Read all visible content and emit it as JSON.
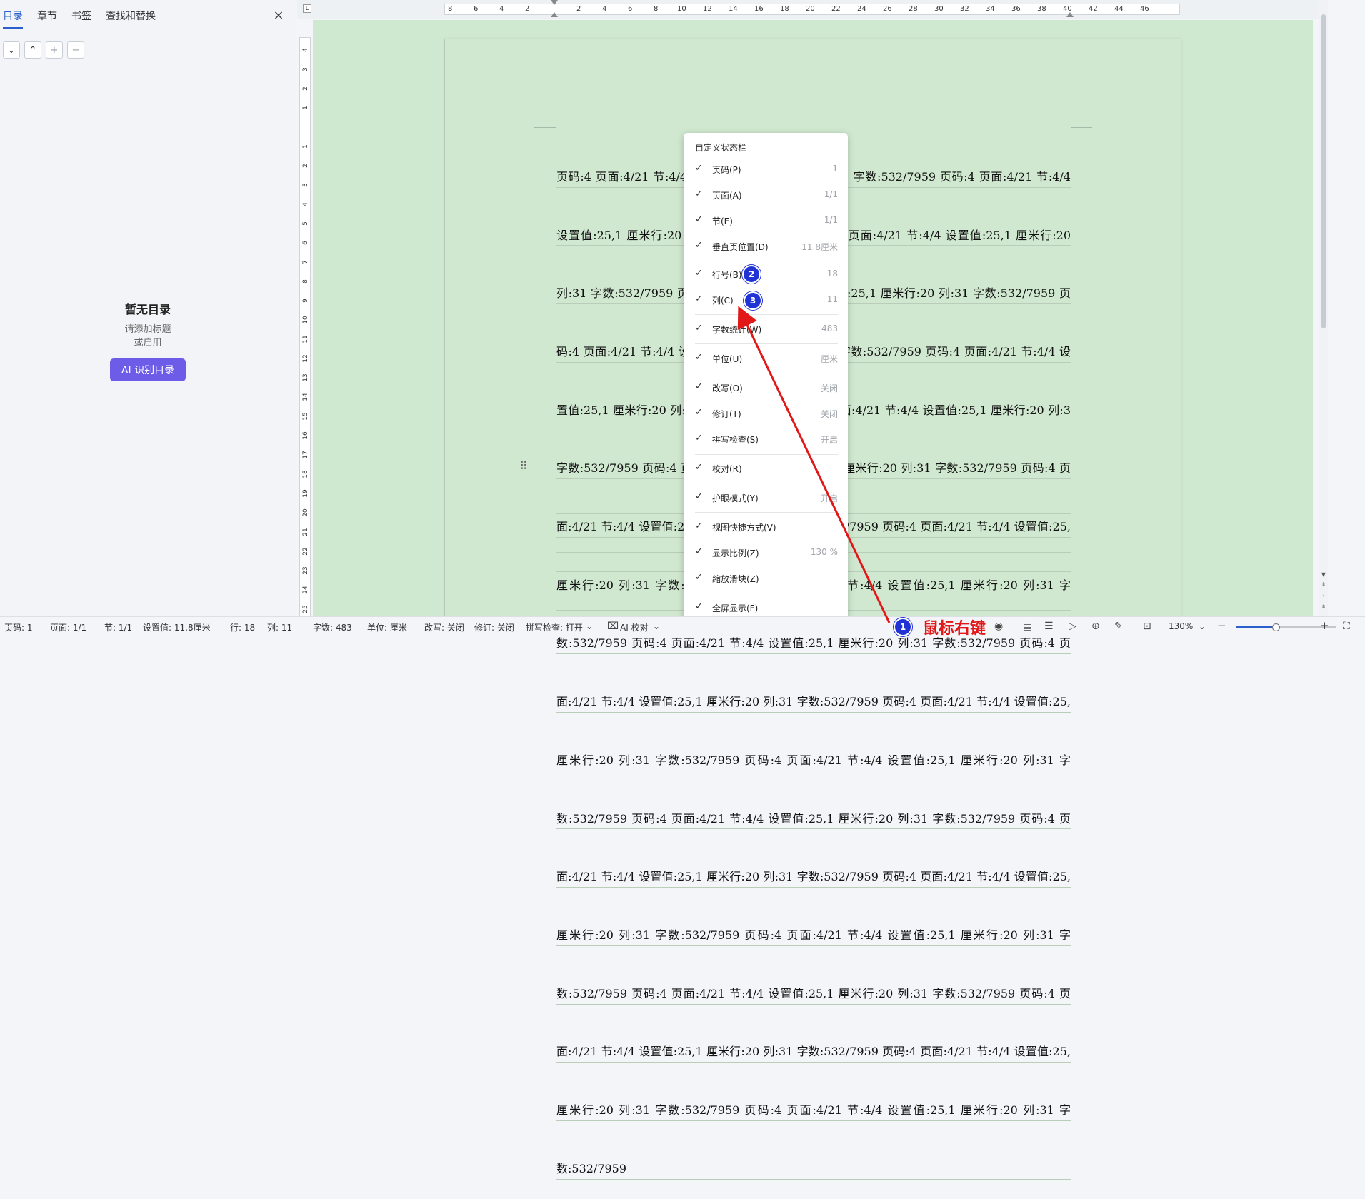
{
  "left_panel": {
    "tabs": [
      "目录",
      "章节",
      "书签",
      "查找和替换"
    ],
    "close_icon": "close-icon",
    "toc_tools": [
      "chevron-down-icon",
      "chevron-up-icon",
      "plus-icon",
      "minus-icon"
    ],
    "empty_title": "暂无目录",
    "empty_hint_1": "请添加标题",
    "empty_hint_2": "或启用",
    "ai_button": "AI 识别目录"
  },
  "hruler_ticks": [
    "8",
    "6",
    "4",
    "2",
    "2",
    "4",
    "6",
    "8",
    "10",
    "12",
    "14",
    "16",
    "18",
    "20",
    "22",
    "24",
    "26",
    "28",
    "30",
    "32",
    "34",
    "36",
    "38",
    "40",
    "42",
    "44",
    "46"
  ],
  "vruler_ticks": [
    "4",
    "3",
    "2",
    "1",
    "1",
    "2",
    "3",
    "4",
    "5",
    "6",
    "7",
    "8",
    "9",
    "10",
    "11",
    "12",
    "13",
    "14",
    "15",
    "16",
    "17",
    "18",
    "19",
    "20",
    "21",
    "22",
    "23",
    "24",
    "25"
  ],
  "document": {
    "lines": [
      "页码:4 页面:4/21 节:4/4 设置值:25,1 厘米行:20 列:31 字数:532/7959 页码:4 页面:4/21 节:4/4",
      "设置值:25,1 厘米行:20 列:31 字数:532/7959 页码:4 页面:4/21 节:4/4 设置值:25,1 厘米行:20",
      "列:31 字数:532/7959 页码:4 页面:4/21 节:4/4 设置值:25,1 厘米行:20 列:31 字数:532/7959 页",
      "码:4 页面:4/21 节:4/4 设置值:25,1 厘米行:20 列:31 字数:532/7959 页码:4 页面:4/21 节:4/4 设",
      "置值:25,1 厘米行:20 列:31 字数:532/7959 页码:4 页面:4/21 节:4/4 设置值:25,1 厘米行:20 列:31",
      "字数:532/7959 页码:4 页面:4/21 节:4/4 设置值:25,1 厘米行:20 列:31 字数:532/7959 页码:4 页",
      "面:4/21 节:4/4 设置值:25,1 厘米行:20 列:31 字数:532/7959 页码:4 页面:4/21 节:4/4 设置值:25,1",
      "厘米行:20 列:31 字数:532/7959 页码:4 页面:4/21 节:4/4 设置值:25,1 厘米行:20 列:31 字",
      "数:532/7959 页码:4 页面:4/21 节:4/4 设置值:25,1 厘米行:20 列:31 字数:532/7959 页码:4 页",
      "面:4/21 节:4/4 设置值:25,1 厘米行:20 列:31 字数:532/7959 页码:4 页面:4/21 节:4/4 设置值:25,1",
      "厘米行:20 列:31 字数:532/7959 页码:4 页面:4/21 节:4/4 设置值:25,1 厘米行:20 列:31 字",
      "数:532/7959 页码:4 页面:4/21 节:4/4 设置值:25,1 厘米行:20 列:31 字数:532/7959 页码:4 页",
      "面:4/21 节:4/4 设置值:25,1 厘米行:20 列:31 字数:532/7959 页码:4 页面:4/21 节:4/4 设置值:25,1",
      "厘米行:20 列:31 字数:532/7959 页码:4 页面:4/21 节:4/4 设置值:25,1 厘米行:20 列:31 字",
      "数:532/7959 页码:4 页面:4/21 节:4/4 设置值:25,1 厘米行:20 列:31 字数:532/7959 页码:4 页",
      "面:4/21 节:4/4 设置值:25,1 厘米行:20 列:31 字数:532/7959 页码:4 页面:4/21 节:4/4 设置值:25,1",
      "厘米行:20 列:31 字数:532/7959 页码:4 页面:4/21 节:4/4 设置值:25,1 厘米行:20 列:31 字",
      "数:532/7959"
    ]
  },
  "context_menu": {
    "title": "自定义状态栏",
    "items": [
      {
        "label": "页码(P)",
        "value": "1"
      },
      {
        "label": "页面(A)",
        "value": "1/1"
      },
      {
        "label": "节(E)",
        "value": "1/1"
      },
      {
        "label": "垂直页位置(D)",
        "value": "11.8厘米"
      },
      {
        "label": "行号(B)",
        "value": "18"
      },
      {
        "label": "列(C)",
        "value": "11"
      },
      {
        "label": "字数统计(W)",
        "value": "483"
      },
      {
        "label": "单位(U)",
        "value": "厘米"
      },
      {
        "label": "改写(O)",
        "value": "关闭"
      },
      {
        "label": "修订(T)",
        "value": "关闭"
      },
      {
        "label": "拼写检查(S)",
        "value": "开启"
      },
      {
        "label": "校对(R)",
        "value": ""
      },
      {
        "label": "护眼模式(Y)",
        "value": "开启"
      },
      {
        "label": "视图快捷方式(V)",
        "value": ""
      },
      {
        "label": "显示比例(Z)",
        "value": "130 %"
      },
      {
        "label": "缩放滑块(Z)",
        "value": ""
      },
      {
        "label": "全屏显示(F)",
        "value": ""
      }
    ]
  },
  "annotations": {
    "badge1": "1",
    "badge2": "2",
    "badge3": "3",
    "right_click_text": "鼠标右键",
    "color": "#e21818"
  },
  "statusbar": {
    "page_num": "页码: 1",
    "page": "页面: 1/1",
    "section": "节: 1/1",
    "setting": "设置值: 11.8厘米",
    "row": "行: 18",
    "col": "列: 11",
    "word_count": "字数: 483",
    "unit": "单位: 厘米",
    "overwrite": "改写: 关闭",
    "revision": "修订: 关闭",
    "spellcheck": "拼写检查: 打开",
    "proofread": "AI 校对",
    "zoom": "130%",
    "zoom_level": 0.4
  },
  "colors": {
    "accent": "#2b5fce",
    "ai_button": "#6d5ce8",
    "eye_care_bg": "#cfe8d0",
    "badge": "#2233d6"
  }
}
